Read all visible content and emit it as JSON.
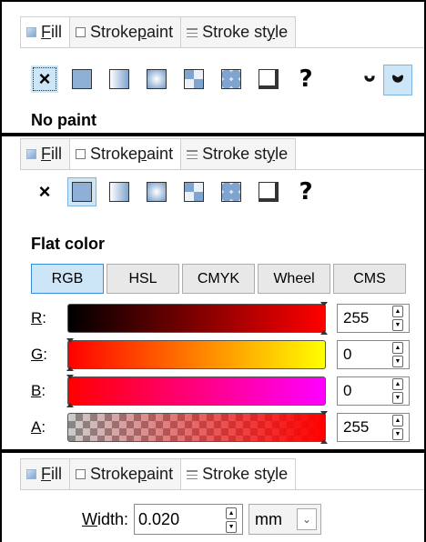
{
  "panels": [
    {
      "tabs": [
        {
          "icon": "fill-icon",
          "label": "Fill",
          "mnemonic": "F",
          "rest": "ill",
          "active": true
        },
        {
          "icon": "stroke-paint-icon",
          "label": "Stroke paint",
          "prefix": "Stroke ",
          "mnemonic": "p",
          "rest": "aint",
          "active": false
        },
        {
          "icon": "stroke-style-icon",
          "label": "Stroke style",
          "prefix": "Stroke st",
          "mnemonic": "y",
          "rest": "le",
          "active": false
        }
      ],
      "paint_buttons": [
        "no-paint",
        "flat-color",
        "linear-gradient",
        "radial-gradient",
        "mesh-gradient",
        "pattern",
        "swatch",
        "unset"
      ],
      "selected_paint": "no-paint",
      "fill_rule_icons": [
        "fill-rule-evenodd-icon",
        "fill-rule-nonzero-icon"
      ],
      "mode_title": "No paint"
    },
    {
      "tabs": [
        {
          "icon": "fill-icon",
          "label": "Fill",
          "mnemonic": "F",
          "rest": "ill",
          "active": false
        },
        {
          "icon": "stroke-paint-icon",
          "label": "Stroke paint",
          "prefix": "Stroke ",
          "mnemonic": "p",
          "rest": "aint",
          "active": true
        },
        {
          "icon": "stroke-style-icon",
          "label": "Stroke style",
          "prefix": "Stroke st",
          "mnemonic": "y",
          "rest": "le",
          "active": false
        }
      ],
      "selected_paint": "flat-color",
      "mode_title": "Flat color",
      "color_modes": [
        "RGB",
        "HSL",
        "CMYK",
        "Wheel",
        "CMS"
      ],
      "active_color_mode": "RGB",
      "sliders": [
        {
          "label": "R:",
          "mnemonic": "R",
          "value": "255"
        },
        {
          "label": "G:",
          "mnemonic": "G",
          "value": "0"
        },
        {
          "label": "B:",
          "mnemonic": "B",
          "value": "0"
        },
        {
          "label": "A:",
          "mnemonic": "A",
          "value": "255"
        }
      ]
    },
    {
      "tabs": [
        {
          "icon": "fill-icon",
          "label": "Fill",
          "mnemonic": "F",
          "rest": "ill",
          "active": false
        },
        {
          "icon": "stroke-paint-icon",
          "label": "Stroke paint",
          "prefix": "Stroke ",
          "mnemonic": "p",
          "rest": "aint",
          "active": false
        },
        {
          "icon": "stroke-style-icon",
          "label": "Stroke style",
          "prefix": "Stroke st",
          "mnemonic": "y",
          "rest": "le",
          "active": true
        }
      ],
      "width_label": "Width:",
      "width_mnemonic": "W",
      "width_rest": "idth:",
      "width_value": "0.020",
      "unit": "mm"
    }
  ],
  "glyphs": {
    "none": "×",
    "unset": "?"
  }
}
